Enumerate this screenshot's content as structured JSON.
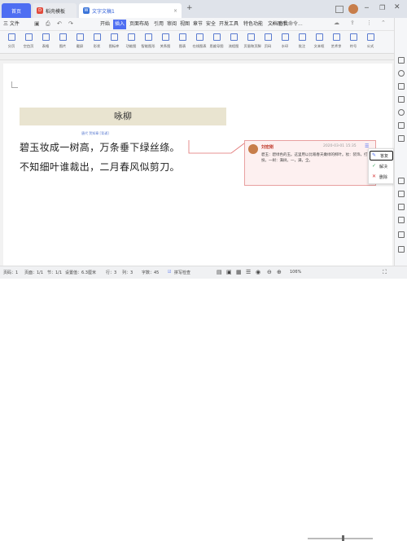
{
  "tabs": {
    "home": "首页",
    "template": "稻壳模板",
    "doc": "文字文稿1",
    "add": "+"
  },
  "menu": {
    "file": "三 文件",
    "items": [
      "开始",
      "插入",
      "页面布局",
      "引用",
      "审阅",
      "视图",
      "章节",
      "安全",
      "开发工具",
      "特色功能",
      "文档助手"
    ],
    "active_index": 1,
    "search": "查找命令..."
  },
  "toolbar": {
    "buttons": [
      "分页",
      "空白页",
      "表格",
      "图片",
      "截屏",
      "形状",
      "图标库",
      "功能图",
      "智能图形",
      "关系图",
      "图表",
      "在线图表",
      "思维导图",
      "流程图",
      "页眉和页脚",
      "页码",
      "水印",
      "批注",
      "文本框",
      "艺术字",
      "符号",
      "公式"
    ]
  },
  "document": {
    "poem_title": "咏柳",
    "byline": "唐代  贺知章  [背诵]",
    "line1": "碧玉妆成一树高，万条垂下绿丝绦。",
    "line2": "不知细叶谁裁出，二月春风似剪刀。"
  },
  "comment": {
    "author": "刘宏刚",
    "date": "2020-03-01 15:35",
    "text": "碧玉：碧绿色的玉。这里用以比喻春天嫩绿的柳叶。妆：装饰，打扮。一树：满树。一，满，全。"
  },
  "context_menu": {
    "reply": "答复",
    "resolve": "解决",
    "delete": "删除"
  },
  "status": {
    "page_num": "页码：1",
    "pages": "页面：1/1",
    "section": "节：1/1",
    "setting": "设置值：6.3厘米",
    "row": "行：3",
    "col": "列：3",
    "words": "字数：45",
    "spellcheck": "拼写检查",
    "zoom": "106%"
  },
  "colors": {
    "accent": "#4e6ef2",
    "comment_border": "#e8a0a0",
    "comment_bg": "#fdf0f0",
    "title_band": "#e9e4d0"
  }
}
